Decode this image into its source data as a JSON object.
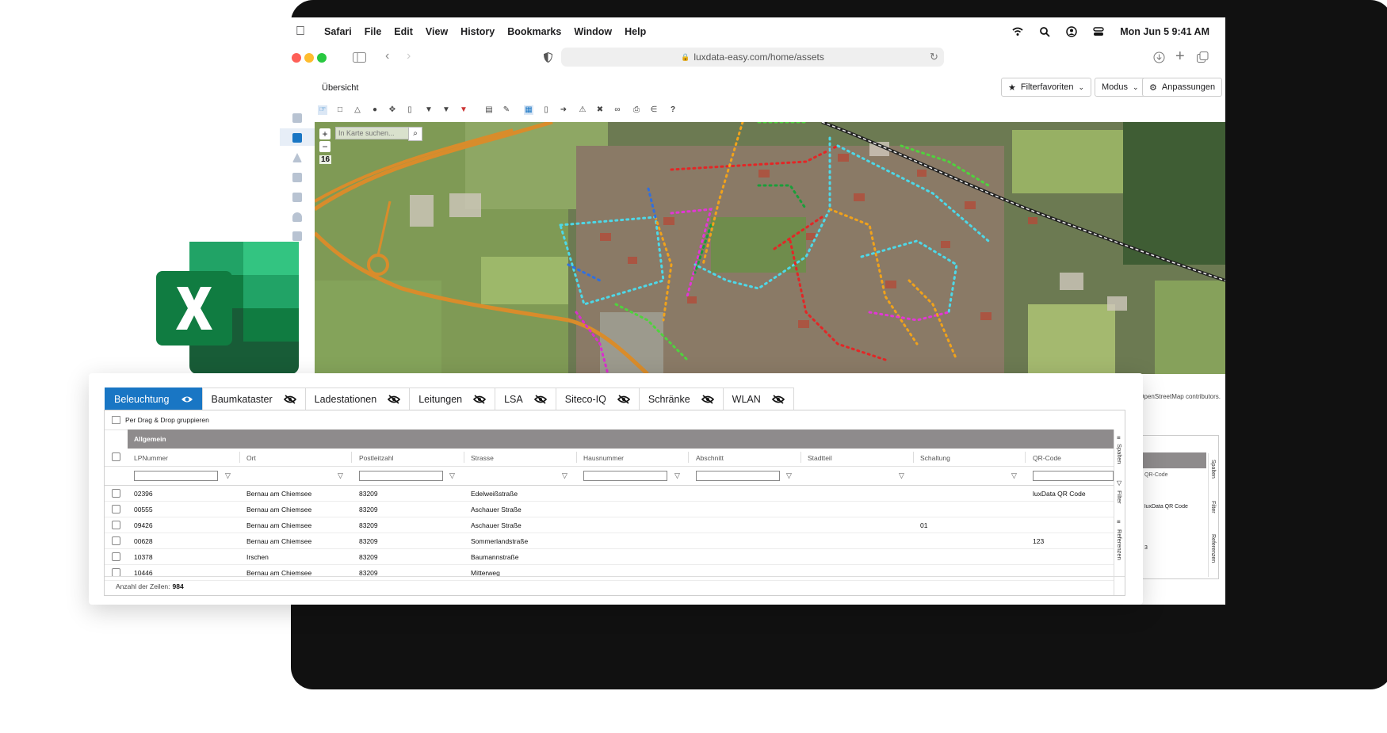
{
  "menubar": {
    "app": "Safari",
    "items": [
      "File",
      "Edit",
      "View",
      "History",
      "Bookmarks",
      "Window",
      "Help"
    ],
    "datetime": "Mon Jun 5  9:41 AM"
  },
  "browser": {
    "url": "luxdata-easy.com/home/assets"
  },
  "app": {
    "title": "Übersicht",
    "filter_favorites": "Filterfavoriten",
    "mode": "Modus",
    "customize": "Anpassungen"
  },
  "map": {
    "search_placeholder": "In Karte suchen...",
    "zoom_in": "+",
    "zoom_out": "−",
    "zoom_level": "16",
    "help": "?",
    "credit": "OpenStreetMap contributors."
  },
  "tabs": [
    {
      "label": "Beleuchtung",
      "active": true
    },
    {
      "label": "Baumkataster"
    },
    {
      "label": "Ladestationen"
    },
    {
      "label": "Leitungen"
    },
    {
      "label": "LSA"
    },
    {
      "label": "Siteco-IQ"
    },
    {
      "label": "Schränke"
    },
    {
      "label": "WLAN"
    }
  ],
  "grid": {
    "group_hint": "Per Drag & Drop gruppieren",
    "band": "Allgemein",
    "columns": [
      "LPNummer",
      "Ort",
      "Postleitzahl",
      "Strasse",
      "Hausnummer",
      "Abschnitt",
      "Stadtteil",
      "Schaltung",
      "QR-Code"
    ],
    "rows": [
      [
        "02396",
        "Bernau am Chiemsee",
        "83209",
        "Edelweißstraße",
        "",
        "",
        "",
        "",
        "luxData QR Code"
      ],
      [
        "00555",
        "Bernau am Chiemsee",
        "83209",
        "Aschauer Straße",
        "",
        "",
        "",
        "",
        ""
      ],
      [
        "09426",
        "Bernau am Chiemsee",
        "83209",
        "Aschauer Straße",
        "",
        "",
        "",
        "01",
        ""
      ],
      [
        "00628",
        "Bernau am Chiemsee",
        "83209",
        "Sommerlandstraße",
        "",
        "",
        "",
        "",
        "123"
      ],
      [
        "10378",
        "Irschen",
        "83209",
        "Baumannstraße",
        "",
        "",
        "",
        "",
        ""
      ],
      [
        "10446",
        "Bernau am Chiemsee",
        "83209",
        "Mitterweg",
        "",
        "",
        "",
        "",
        ""
      ]
    ],
    "side_labels": [
      "Spalten",
      "Filter",
      "Referenzen"
    ],
    "row_count_label": "Anzahl der Zeilen:",
    "row_count": "984"
  },
  "back_grid": {
    "qr_header": "QR-Code",
    "qr_value": "luxData QR Code",
    "value": "3"
  },
  "colors": {
    "accent": "#1976c4",
    "band": "#8e8b8c",
    "excel_dark": "#185c37",
    "excel_mid": "#21a366",
    "excel_light": "#33c481",
    "excel_front": "#107c41"
  }
}
